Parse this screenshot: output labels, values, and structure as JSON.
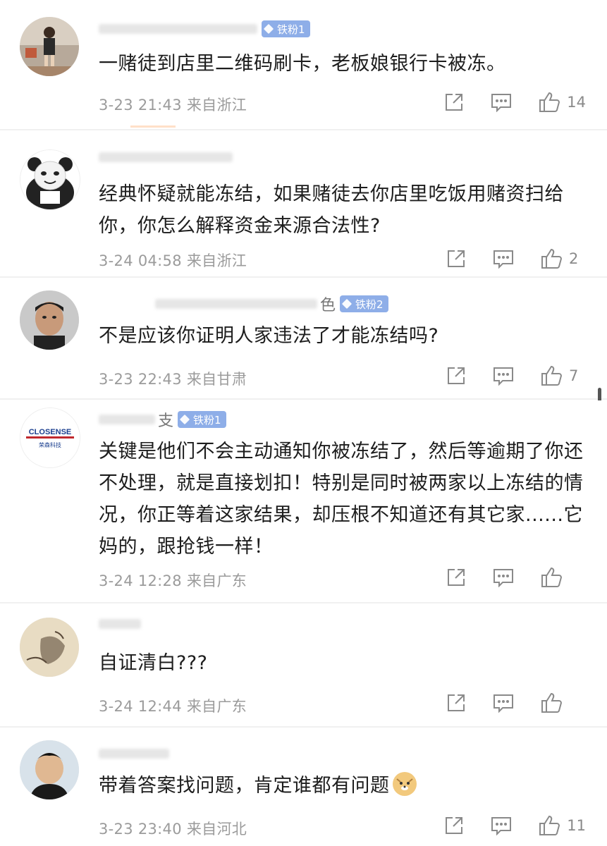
{
  "comments": [
    {
      "badge": "铁粉1",
      "text": "一赌徒到店里二维码刷卡，老板娘银行卡被冻。",
      "time": "3-23 21:43",
      "location": "来自浙江",
      "likes": "14"
    },
    {
      "badge": "",
      "text": "经典怀疑就能冻结，如果赌徒去你店里吃饭用赌资扫给你，你怎么解释资金来源合法性?",
      "time": "3-24 04:58",
      "location": "来自浙江",
      "likes": "2"
    },
    {
      "name_end": "色",
      "badge": "铁粉2",
      "text": "不是应该你证明人家违法了才能冻结吗?",
      "time": "3-23 22:43",
      "location": "来自甘肃",
      "likes": "7"
    },
    {
      "name_end": "支",
      "badge": "铁粉1",
      "text": "关键是他们不会主动通知你被冻结了，然后等逾期了你还不处理，就是直接划扣！特别是同时被两家以上冻结的情况，你正等着这家结果，却压根不知道还有其它家......它妈的，跟抢钱一样！",
      "time": "3-24 12:28",
      "location": "来自广东",
      "likes": ""
    },
    {
      "badge": "",
      "text": "自证清白???",
      "time": "3-24 12:44",
      "location": "来自广东",
      "likes": ""
    },
    {
      "badge": "",
      "text": "带着答案找问题，肯定谁都有问题",
      "time": "3-23 23:40",
      "location": "来自河北",
      "likes": "11"
    }
  ],
  "avatar4_logo": "CLOSENSE",
  "avatar4_sub": "荣森科技",
  "emoji_name": "doge-emoji",
  "colors": {
    "badge": "#8eaee8",
    "meta": "#9b9b9b",
    "icon": "#8a8a8a"
  }
}
